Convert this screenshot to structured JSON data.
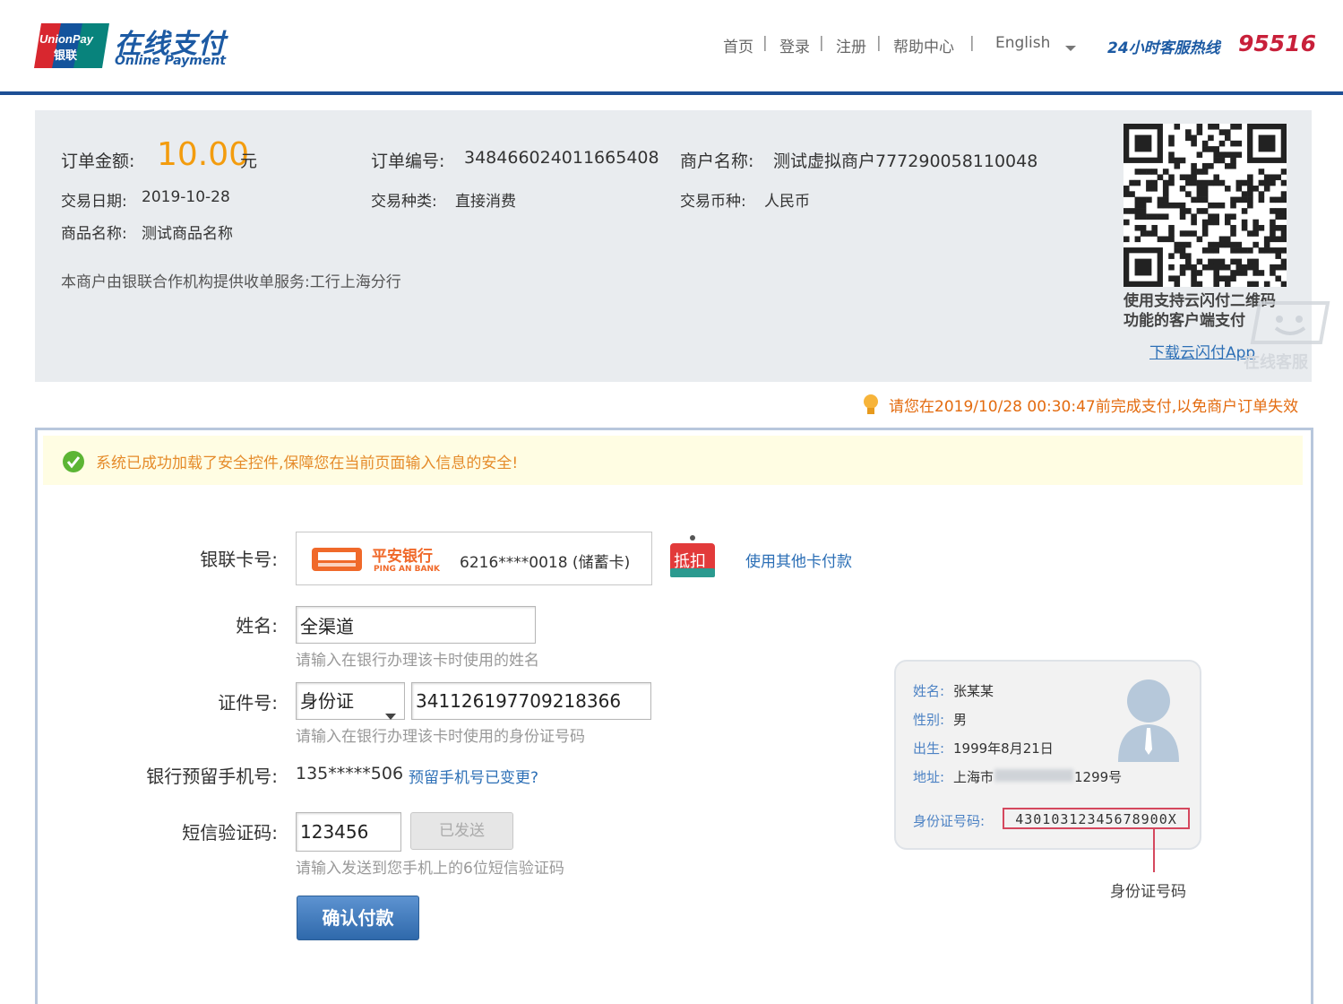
{
  "header": {
    "logo_en": "UnionPay",
    "logo_cn": "银联",
    "logo_title": "在线支付",
    "logo_subtitle": "Online Payment",
    "nav": [
      "首页",
      "登录",
      "注册",
      "帮助中心"
    ],
    "language": "English",
    "hotline_label": "24小时客服热线",
    "hotline_number": "95516"
  },
  "order": {
    "amount_label": "订单金额:",
    "amount": "10.00",
    "amount_unit": "元",
    "order_no_label": "订单编号:",
    "order_no": "348466024011665408",
    "merchant_label": "商户名称:",
    "merchant": "测试虚拟商户777290058110048",
    "date_label": "交易日期:",
    "date": "2019-10-28",
    "type_label": "交易种类:",
    "type": "直接消费",
    "currency_label": "交易币种:",
    "currency": "人民币",
    "goods_label": "商品名称:",
    "goods": "测试商品名称",
    "service_note": "本商户由银联合作机构提供收单服务:工行上海分行",
    "qr_note_line1": "使用支持云闪付二维码",
    "qr_note_line2": "功能的客户端支付",
    "qr_download": "下载云闪付App",
    "online_service": "在线客服"
  },
  "deadline": "请您在2019/10/28 00:30:47前完成支付,以免商户订单失效",
  "security_notice": "系统已成功加载了安全控件,保障您在当前页面输入信息的安全!",
  "form": {
    "card_label": "银联卡号:",
    "bank_logo_cn": "平安银行",
    "bank_logo_en": "PING AN BANK",
    "card_number": "6216****0018 (储蓄卡)",
    "discount_badge": "抵扣",
    "other_card": "使用其他卡付款",
    "name_label": "姓名:",
    "name_value": "全渠道",
    "name_hint": "请输入在银行办理该卡时使用的姓名",
    "id_label": "证件号:",
    "id_type": "身份证",
    "id_value": "341126197709218366",
    "id_hint": "请输入在银行办理该卡时使用的身份证号码",
    "phone_label": "银行预留手机号:",
    "phone_value": "135*****506",
    "phone_change": "预留手机号已变更?",
    "sms_label": "短信验证码:",
    "sms_value": "123456",
    "sms_button": "已发送",
    "sms_hint": "请输入发送到您手机上的6位短信验证码",
    "confirm_button": "确认付款"
  },
  "id_card": {
    "name_key": "姓名:",
    "name": "张某某",
    "sex_key": "性别:",
    "sex": "男",
    "birth_key": "出生:",
    "birth": "1999年8月21日",
    "addr_key": "地址:",
    "addr": "上海市",
    "addr_tail": "1299号",
    "idno_key": "身份证号码:",
    "idno": "43010312345678900X",
    "caption": "身份证号码"
  },
  "colors": {
    "brand_blue": "#1d4f95",
    "amount_orange": "#f39c0e",
    "hotline_red": "#c8203a",
    "link_blue": "#2c6fb6"
  }
}
